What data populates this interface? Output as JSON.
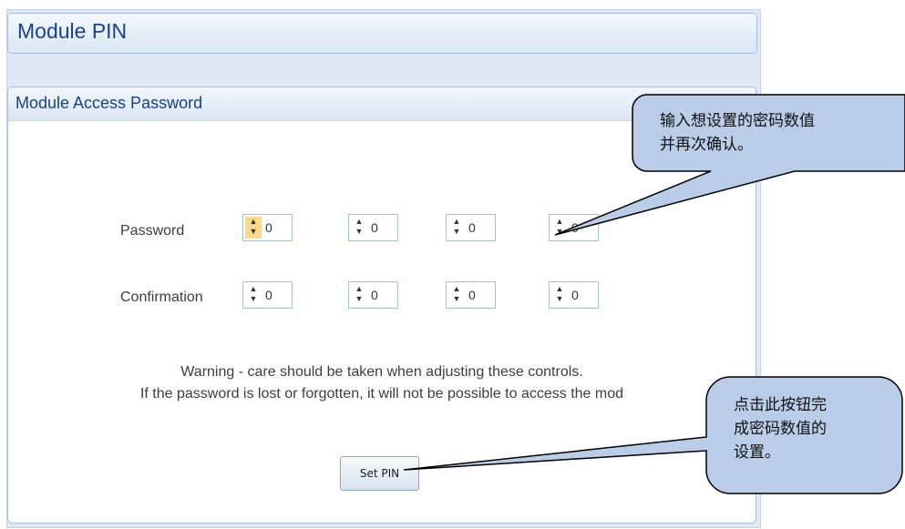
{
  "page": {
    "title": "Module PIN"
  },
  "group": {
    "title": "Module Access Password"
  },
  "fields": {
    "password_label": "Password",
    "confirmation_label": "Confirmation",
    "password_values": [
      "0",
      "0",
      "0",
      "0"
    ],
    "confirmation_values": [
      "0",
      "0",
      "0",
      "0"
    ]
  },
  "warning": {
    "line1": "Warning - care should be taken when adjusting these controls.",
    "line2": "If the password is lost or forgotten, it will not be possible to access the mod"
  },
  "button": {
    "set_pin": "Set PIN"
  },
  "callouts": {
    "password_line1": "输入想设置的密码数值",
    "password_line2": "并再次确认。",
    "button_line1": "点击此按钮完",
    "button_line2": "成密码数值的",
    "button_line3": "设置。"
  },
  "colors": {
    "title_text": "#15428b",
    "panel_bg": "#dfe9f5",
    "active_spinner": "#fbd98b",
    "callout_fill": "#b9cde8"
  }
}
